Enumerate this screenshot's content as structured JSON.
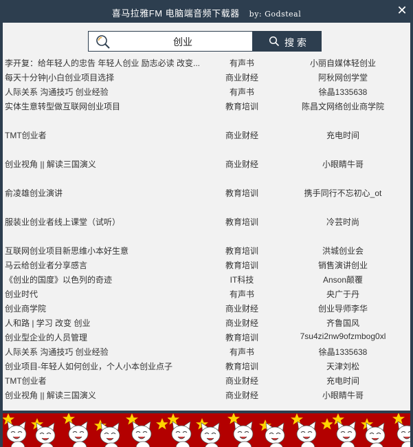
{
  "window": {
    "title": "喜马拉雅FM 电脑端音频下载器",
    "author": "by: Godsteal",
    "close_glyph": "✕",
    "bg_color": "#2d3e4f",
    "content_bg": "#f2f2f2"
  },
  "search": {
    "value": "创业",
    "button_label": "搜索",
    "icon": "search-icon"
  },
  "results": [
    {
      "title": "李开复：给年轻人的忠告 年轻人创业 励志必读 改变...",
      "category": "有声书",
      "author": "小丽自媒体轻创业"
    },
    {
      "title": "每天十分钟|小白创业项目选择",
      "category": "商业财经",
      "author": "阿秋网创学堂"
    },
    {
      "title": "人际关系 沟通技巧 创业经验",
      "category": "有声书",
      "author": "徐晶1335638"
    },
    {
      "title": "实体生意转型做互联网创业项目",
      "category": "教育培训",
      "author": "陈昌文网络创业商学院"
    },
    {
      "title": "TMT创业者",
      "category": "商业财经",
      "author": "充电时间"
    },
    {
      "title": "创业视角 || 解读三国演义",
      "category": "商业财经",
      "author": "小眼睛牛哥"
    },
    {
      "title": "俞凌雄创业演讲",
      "category": "教育培训",
      "author": "携手同行不忘初心_ot"
    },
    {
      "title": "服装业创业者线上课堂（试听）",
      "category": "教育培训",
      "author": "冷芸时尚"
    },
    {
      "title": "互联网创业项目新思维小本好生意",
      "category": "教育培训",
      "author": "洪城创业会"
    },
    {
      "title": "马云给创业者分享感言",
      "category": "教育培训",
      "author": "销售演讲创业"
    },
    {
      "title": "《创业的国度》以色列的奇迹",
      "category": "IT科技",
      "author": "Anson颠覆"
    },
    {
      "title": "创业时代",
      "category": "有声书",
      "author": "央广于丹"
    },
    {
      "title": "创业商学院",
      "category": "商业财经",
      "author": "创业导师李华"
    },
    {
      "title": "人和路 | 学习 改变 创业",
      "category": "商业财经",
      "author": "齐鲁国风"
    },
    {
      "title": "创业型企业的人员管理",
      "category": "教育培训",
      "author": "7su4zi2nw9ofzmbog0xl"
    },
    {
      "title": "人际关系 沟通技巧 创业经验",
      "category": "有声书",
      "author": "徐晶1335638"
    },
    {
      "title": "创业项目-年轻人如何创业，个人小本创业点子",
      "category": "教育培训",
      "author": "天津刘松"
    },
    {
      "title": "TMT创业者",
      "category": "商业财经",
      "author": "充电时间"
    },
    {
      "title": "创业视角 || 解读三国演义",
      "category": "商业财经",
      "author": "小眼睛牛哥"
    }
  ],
  "banner": {
    "icons": [
      "cat-mascot-icon",
      "star-icon"
    ],
    "bg_color": "#b30000"
  }
}
